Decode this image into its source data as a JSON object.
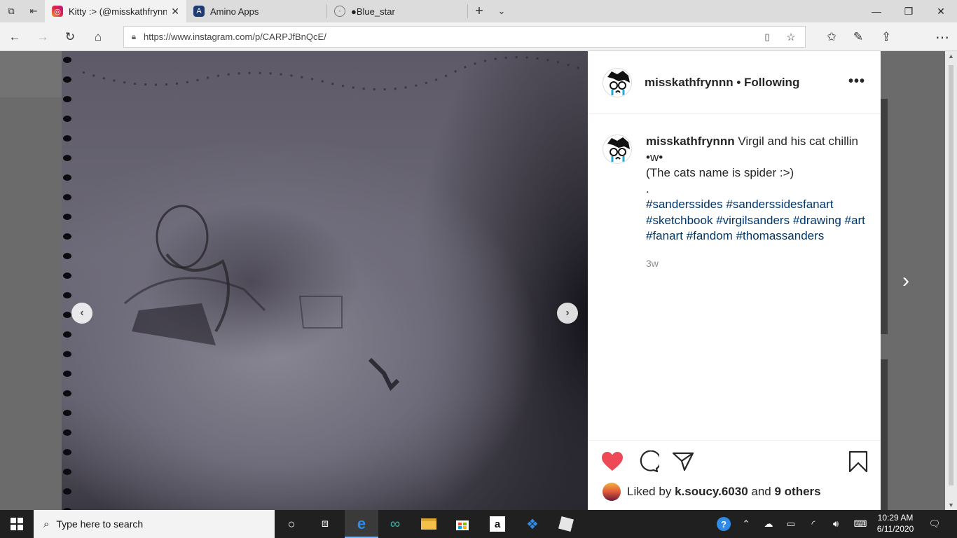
{
  "browser": {
    "tabs": [
      {
        "label": "Kitty :> (@misskathfrynn",
        "icon": "instagram-icon",
        "active": true
      },
      {
        "label": "Amino Apps",
        "icon": "amino-icon",
        "active": false
      },
      {
        "label": "●Blue_star",
        "icon": "globe-icon",
        "active": false
      }
    ],
    "url": "https://www.instagram.com/p/CARPJfBnQcE/"
  },
  "post": {
    "username": "misskathfrynnn",
    "separator": "•",
    "follow_status": "Following",
    "more_label": "•••",
    "caption_user": "misskathfrynnn",
    "caption_line1": " Virgil and his cat chillin •w•",
    "caption_line2": "(The cats name is spider :>)",
    "caption_line3": ".",
    "hashtags": [
      "#sanderssides",
      "#sanderssidesfanart",
      "#sketchbook",
      "#virgilsanders",
      "#drawing",
      "#art",
      "#fanart",
      "#fandom",
      "#thomassanders"
    ],
    "time_ago": "3w",
    "liked_by_prefix": "Liked by ",
    "liked_by_user": "k.soucy.6030",
    "liked_by_and": " and ",
    "liked_by_others": "9 others",
    "colors": {
      "like": "#ed4956",
      "hashtag": "#00376b",
      "text": "#262626"
    }
  },
  "taskbar": {
    "search_placeholder": "Type here to search",
    "time": "10:29 AM",
    "date": "6/11/2020"
  }
}
